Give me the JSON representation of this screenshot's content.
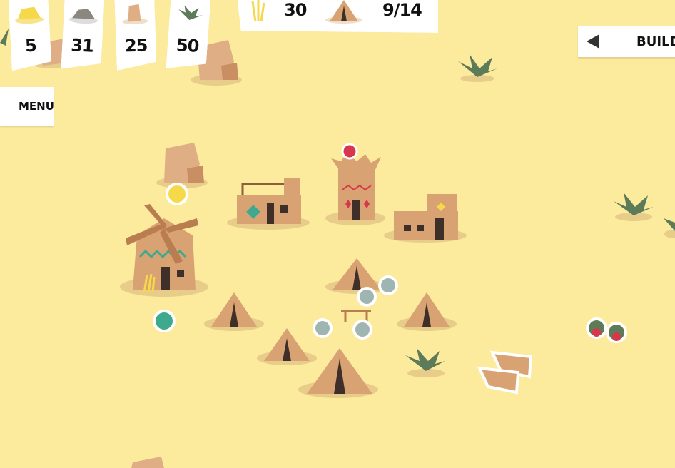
{
  "resources": {
    "gold": {
      "value": "5",
      "icon": "gold-icon"
    },
    "stone": {
      "value": "31",
      "icon": "stone-icon"
    },
    "clay": {
      "value": "25",
      "icon": "clay-icon"
    },
    "plants": {
      "value": "50",
      "icon": "plant-icon"
    }
  },
  "stats": {
    "food": {
      "value": "30",
      "icon": "wheat-icon"
    },
    "population": {
      "value": "9/14",
      "icon": "tent-icon"
    }
  },
  "build_button": {
    "label": "BUILD"
  },
  "menu_button": {
    "label": "MENU"
  },
  "colors": {
    "sand": "#fcea9d",
    "adobe": "#d9a273",
    "adobe_dark": "#b97d50",
    "door": "#3e3029",
    "teal": "#3fa98d",
    "red": "#d8364b",
    "gold": "#f6d94a",
    "plant": "#5d7b58"
  }
}
